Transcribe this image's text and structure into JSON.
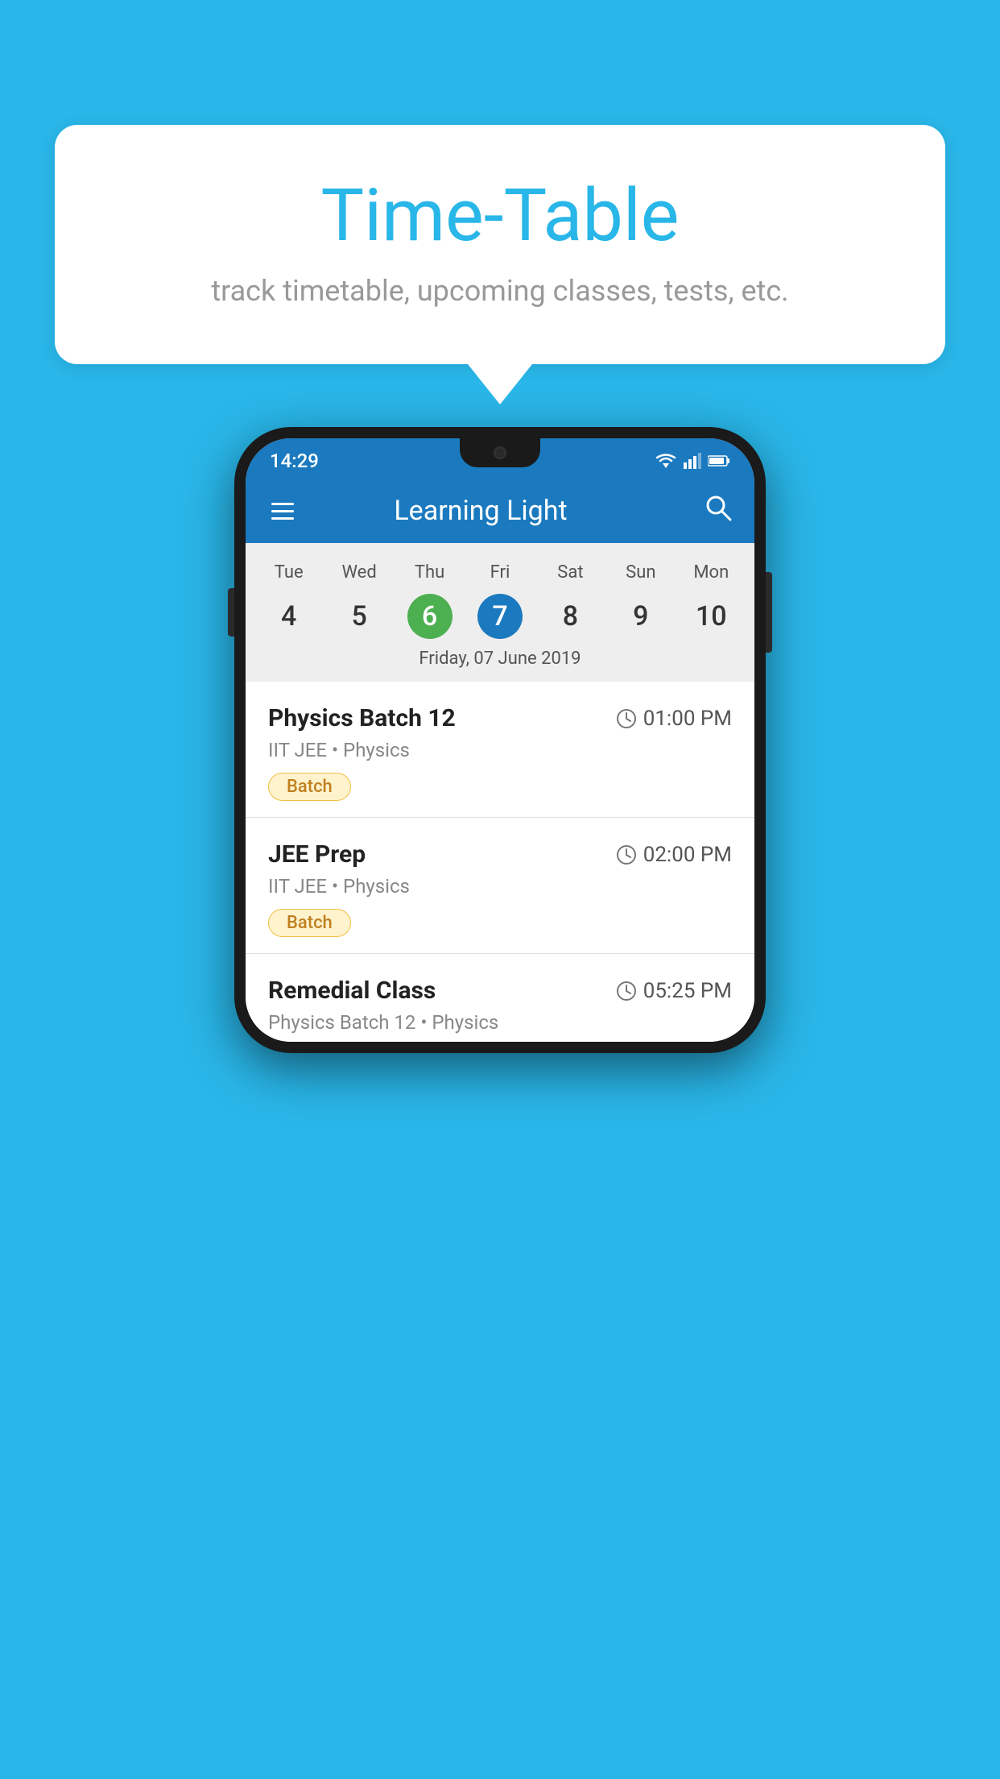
{
  "background": {
    "color": "#29b6e8"
  },
  "speech_bubble": {
    "title": "Time-Table",
    "subtitle": "track timetable, upcoming classes, tests, etc."
  },
  "phone": {
    "status_bar": {
      "time": "14:29"
    },
    "app_bar": {
      "title": "Learning Light"
    },
    "calendar": {
      "days": [
        "Tue",
        "Wed",
        "Thu",
        "Fri",
        "Sat",
        "Sun",
        "Mon"
      ],
      "dates": [
        "4",
        "5",
        "6",
        "7",
        "8",
        "9",
        "10"
      ],
      "today_index": 2,
      "selected_index": 3,
      "selected_date_label": "Friday, 07 June 2019"
    },
    "classes": [
      {
        "name": "Physics Batch 12",
        "time": "01:00 PM",
        "subject": "IIT JEE • Physics",
        "badge": "Batch"
      },
      {
        "name": "JEE Prep",
        "time": "02:00 PM",
        "subject": "IIT JEE • Physics",
        "badge": "Batch"
      },
      {
        "name": "Remedial Class",
        "time": "05:25 PM",
        "subject": "Physics Batch 12 • Physics",
        "badge": null
      }
    ]
  }
}
